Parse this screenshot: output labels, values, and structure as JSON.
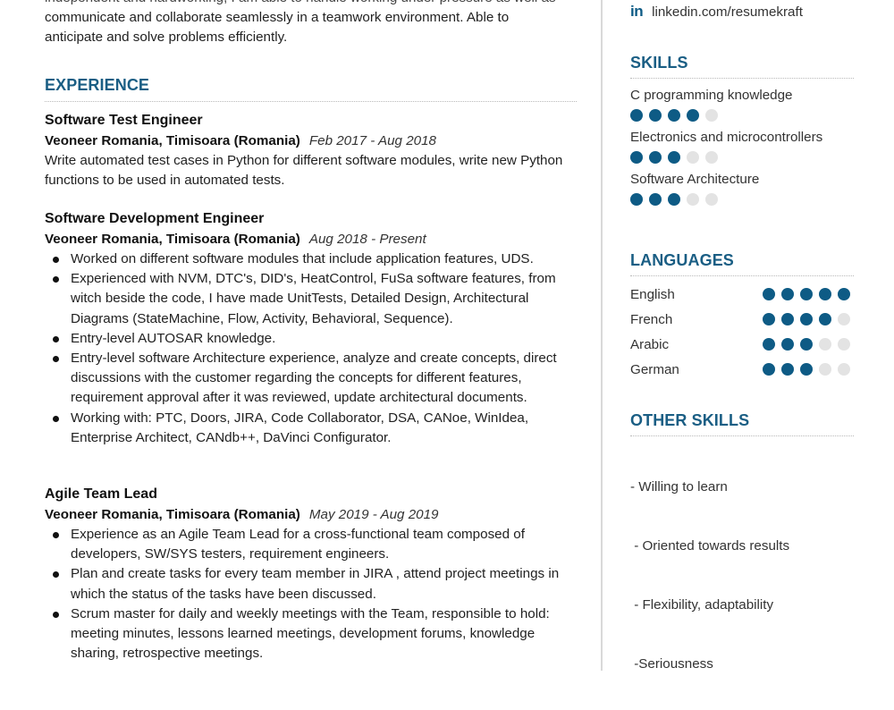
{
  "summary": {
    "cut_line": "independent and hardworking, I am able to handle working under pressure as well as",
    "lines": [
      "communicate and collaborate seamlessly in a teamwork environment. Able to",
      "anticipate and solve problems efficiently."
    ]
  },
  "experience": {
    "title": "EXPERIENCE",
    "jobs": [
      {
        "title": "Software Test Engineer",
        "company": "Veoneer Romania, Timisoara (Romania)",
        "dates": "Feb 2017 - Aug 2018",
        "description": "Write automated test cases in Python for different software modules, write new Python functions to be used in automated tests."
      },
      {
        "title": "Software Development Engineer",
        "company": "Veoneer Romania, Timisoara (Romania)",
        "dates": "Aug 2018 - Present",
        "bullets": [
          "Worked on different software modules that include application features, UDS.",
          "Experienced with NVM, DTC's, DID's, HeatControl, FuSa software features, from witch beside the code, I have made UnitTests, Detailed Design, Architectural Diagrams (StateMachine, Flow, Activity, Behavioral, Sequence).",
          "Entry-level AUTOSAR knowledge.",
          "Entry-level software Architecture experience, analyze and create concepts, direct discussions with the customer regarding the concepts for different features, requirement approval after it was reviewed, update architectural documents.",
          "Working with: PTC, Doors, JIRA, Code Collaborator, DSA, CANoe, WinIdea, Enterprise Architect, CANdb++, DaVinci Configurator."
        ]
      },
      {
        "title": "Agile Team Lead",
        "company": "Veoneer Romania, Timisoara (Romania)",
        "dates": "May 2019 - Aug 2019",
        "bullets": [
          "Experience as an Agile Team Lead for a cross-functional team composed of developers, SW/SYS testers, requirement engineers.",
          "Plan and create tasks for every team member in JIRA , attend project meetings in which the status of the tasks have been discussed.",
          "Scrum master for daily and weekly meetings with the Team, responsible to hold: meeting minutes, lessons learned meetings, development forums, knowledge sharing, retrospective meetings."
        ]
      }
    ]
  },
  "sidebar": {
    "contact": {
      "icon": "linkedin-icon",
      "icon_glyph": "in",
      "linkedin": "linkedin.com/resumekraft"
    },
    "skills": {
      "title": "SKILLS",
      "items": [
        {
          "name": "C programming knowledge",
          "level": 4,
          "max": 5
        },
        {
          "name": "Electronics and microcontrollers",
          "level": 3,
          "max": 5
        },
        {
          "name": "Software Architecture",
          "level": 3,
          "max": 5
        }
      ]
    },
    "languages": {
      "title": "LANGUAGES",
      "items": [
        {
          "name": "English",
          "level": 5,
          "max": 5
        },
        {
          "name": "French",
          "level": 4,
          "max": 5
        },
        {
          "name": "Arabic",
          "level": 3,
          "max": 5
        },
        {
          "name": "German",
          "level": 3,
          "max": 5
        }
      ]
    },
    "other_skills": {
      "title": "OTHER SKILLS",
      "items": [
        "- Willing to learn",
        " - Oriented towards results",
        " - Flexibility, adaptability",
        " -Seriousness"
      ]
    }
  },
  "colors": {
    "accent": "#1a5e84",
    "dot_filled": "#0e5b85",
    "dot_empty": "#e3e3e3"
  }
}
